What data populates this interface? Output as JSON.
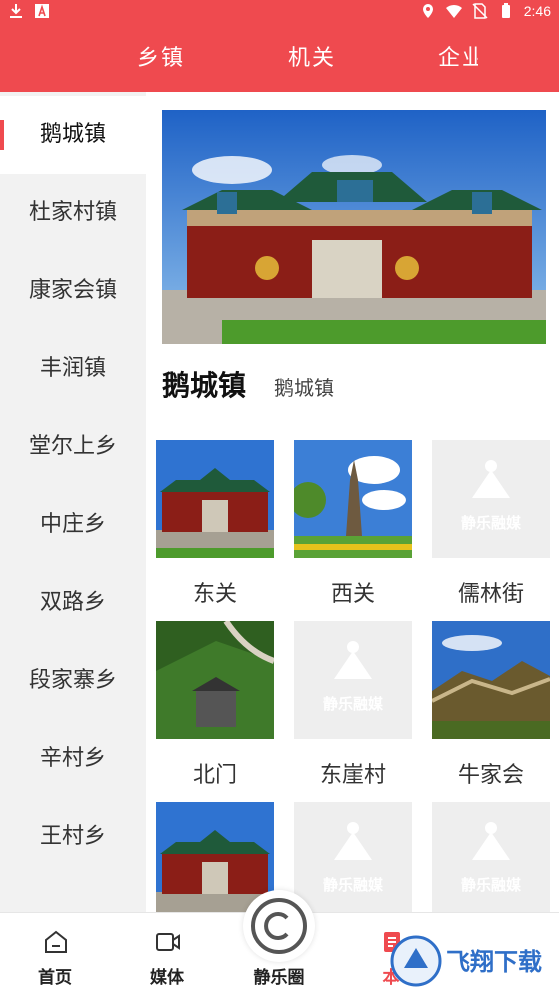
{
  "status": {
    "time": "2:46"
  },
  "tabs": [
    {
      "label": "乡镇"
    },
    {
      "label": "机关"
    },
    {
      "label": "企业"
    }
  ],
  "sidebar": {
    "items": [
      {
        "label": "鹅城镇",
        "active": true
      },
      {
        "label": "杜家村镇"
      },
      {
        "label": "康家会镇"
      },
      {
        "label": "丰润镇"
      },
      {
        "label": "堂尔上乡"
      },
      {
        "label": "中庄乡"
      },
      {
        "label": "双路乡"
      },
      {
        "label": "段家寨乡"
      },
      {
        "label": "辛村乡"
      },
      {
        "label": "王村乡"
      }
    ]
  },
  "main": {
    "title": "鹅城镇",
    "subtitle": "鹅城镇",
    "grid": [
      {
        "label": "东关",
        "image": "archway-photo"
      },
      {
        "label": "西关",
        "image": "pagoda-photo"
      },
      {
        "label": "儒林街",
        "image": "placeholder"
      },
      {
        "label": "北门",
        "image": "greatwall-photo"
      },
      {
        "label": "东崖村",
        "image": "placeholder"
      },
      {
        "label": "牛家会",
        "image": "greatwall-photo"
      },
      {
        "label": "",
        "image": "archway-photo"
      },
      {
        "label": "",
        "image": "placeholder"
      },
      {
        "label": "",
        "image": "placeholder"
      }
    ],
    "placeholder_brand": "静乐融媒"
  },
  "bottom_nav": {
    "items": [
      {
        "label": "首页",
        "icon": "home-icon"
      },
      {
        "label": "媒体",
        "icon": "video-icon"
      },
      {
        "label": "静乐圈",
        "icon": "circle-icon"
      },
      {
        "label": "本",
        "icon": "document-icon"
      }
    ],
    "watermark": "飞翔下载"
  },
  "colors": {
    "accent": "#ef4a4f"
  }
}
